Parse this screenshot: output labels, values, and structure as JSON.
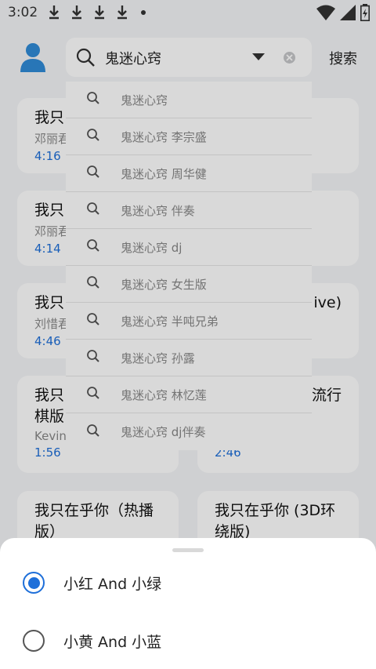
{
  "status_bar": {
    "time": "3:02"
  },
  "search": {
    "query": "鬼迷心窍",
    "submit_label": "搜索"
  },
  "suggestions": [
    "鬼迷心窍",
    "鬼迷心窍 李宗盛",
    "鬼迷心窍 周华健",
    "鬼迷心窍 伴奏",
    "鬼迷心窍 dj",
    "鬼迷心窍 女生版",
    "鬼迷心窍 半吨兄弟",
    "鬼迷心窍 孙露",
    "鬼迷心窍 林忆莲",
    "鬼迷心窍 dj伴奏"
  ],
  "results": [
    {
      "title": "我只",
      "artist": "邓丽君",
      "duration": "4:16 ·"
    },
    {
      "title": "我只",
      "artist": "邓丽君",
      "duration": "4:14 ·"
    },
    {
      "title": "我只",
      "title_right": "ive)",
      "artist": "刘惜君",
      "duration": "4:46"
    },
    {
      "title": "我只",
      "title_line2": "棋版",
      "artist": "Kevin",
      "duration": "1:56"
    },
    {
      "title_right": "流行",
      "duration": "2:46"
    },
    {
      "title": "我只在乎你（热播",
      "title_line2": "版）"
    },
    {
      "title": "我只在乎你 (3D环",
      "title_line2": "绕版)"
    }
  ],
  "sheet": {
    "options": [
      {
        "label": "小红 And 小绿",
        "selected": true
      },
      {
        "label": "小黄 And 小蓝",
        "selected": false
      }
    ]
  },
  "colors": {
    "accent": "#1e6fd9",
    "avatar": "#2f8bd8"
  }
}
